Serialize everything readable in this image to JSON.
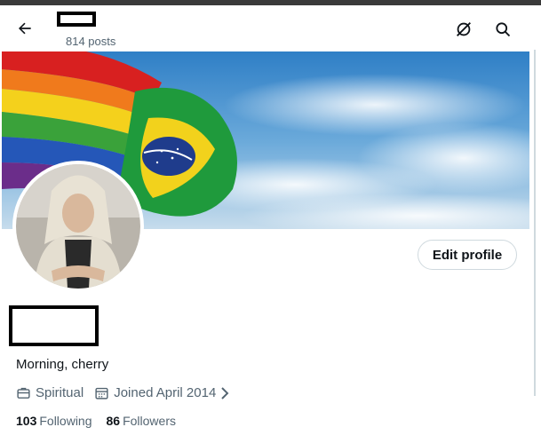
{
  "header": {
    "back_icon": "arrow-left-icon",
    "posts_count": "814 posts",
    "right_icons": [
      "no-space-icon",
      "search-icon"
    ]
  },
  "profile": {
    "edit_profile_label": "Edit profile",
    "bio": "Morning, cherry",
    "category": "Spiritual",
    "joined": "Joined April 2014",
    "following_count": "103",
    "following_label": "Following",
    "followers_count": "86",
    "followers_label": "Followers"
  },
  "colors": {
    "text_primary": "#0f1419",
    "text_secondary": "#536471",
    "border": "#cfd9de"
  }
}
